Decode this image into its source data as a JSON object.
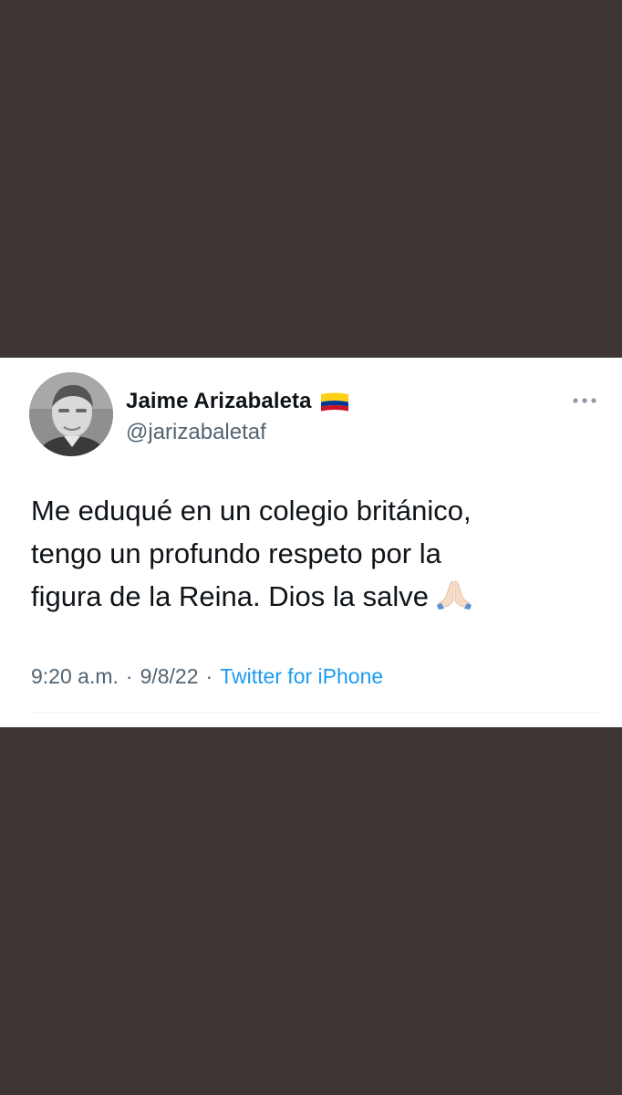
{
  "tweet": {
    "author_name": "Jaime Arizabaleta",
    "author_handle": "@jarizabaletaf",
    "flag_icon": "colombia-flag-icon",
    "text_lines": [
      "Me eduqué en un colegio británico,",
      "tengo un profundo respeto por la",
      "figura de la Reina. Dios la salve"
    ],
    "emoji_icon": "folded-hands-icon",
    "time": "9:20 a.m.",
    "date": "9/8/22",
    "separator": "·",
    "source": "Twitter for iPhone"
  },
  "colors": {
    "background": "#3e3535",
    "card": "#ffffff",
    "text_primary": "#0f1419",
    "text_secondary": "#536471",
    "link": "#1d9bf0"
  }
}
